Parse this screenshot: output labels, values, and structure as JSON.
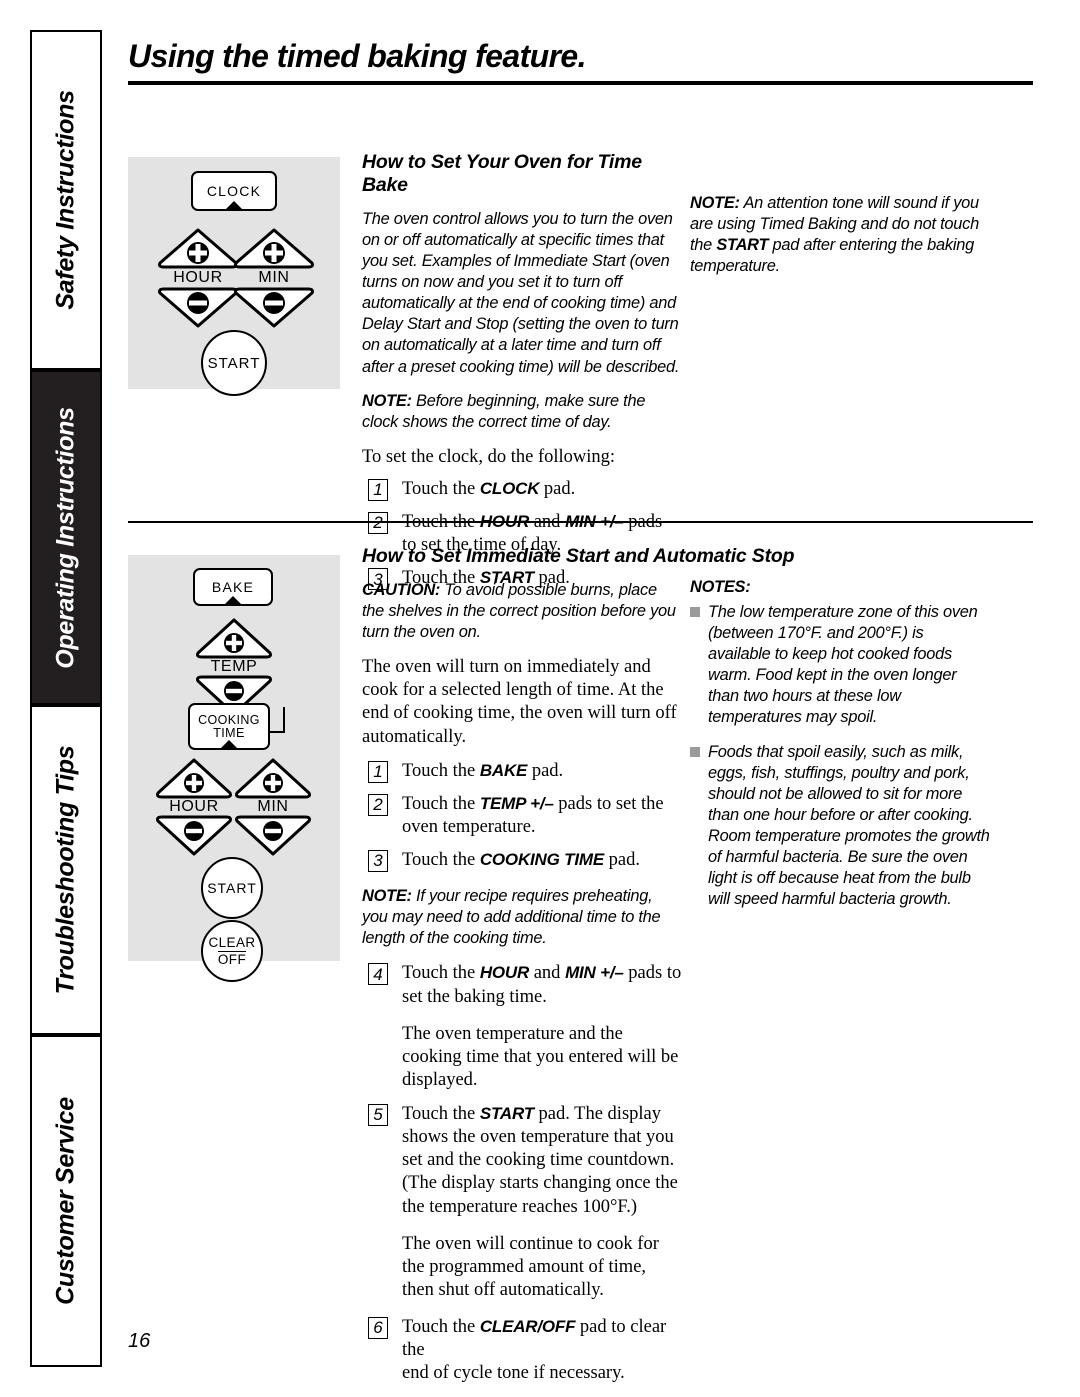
{
  "page": {
    "title": "Using the timed baking feature.",
    "number": "16"
  },
  "sidebar": {
    "tabs": [
      {
        "label": "Safety Instructions",
        "active": false
      },
      {
        "label": "Operating Instructions",
        "active": true
      },
      {
        "label": "Troubleshooting Tips",
        "active": false
      },
      {
        "label": "Customer Service",
        "active": false
      }
    ]
  },
  "colors": {
    "tab_active_bg": "#231f20",
    "panel_bg": "#e3e3e3",
    "bullet_gray": "#9a9a9a",
    "ink": "#000000"
  },
  "section1": {
    "heading": "How to Set Your Oven for Time Bake",
    "panel": {
      "name": "clock-control-panel",
      "pads": [
        {
          "id": "clock",
          "label": "CLOCK",
          "type": "rect"
        },
        {
          "id": "hour",
          "label": "HOUR",
          "type": "plus-minus"
        },
        {
          "id": "min",
          "label": "MIN",
          "type": "plus-minus"
        },
        {
          "id": "start",
          "label": "START",
          "type": "circle"
        }
      ]
    },
    "intro": "The oven control allows you to turn the oven on or off automatically at specific times that you set. Examples of Immediate Start (oven turns on now and you set it to turn off automatically at the end of cooking time) and Delay Start and Stop (setting the oven to turn on automatically at a later time and turn off after a preset cooking time) will be described.",
    "note_label": "NOTE:",
    "note_text": " Before beginning, make sure the clock shows the correct time of day.",
    "lead_in": "To set the clock, do the following:",
    "steps": [
      {
        "num": "1",
        "pre": "Touch the ",
        "pad": "CLOCK",
        "post": " pad.",
        "cont": ""
      },
      {
        "num": "2",
        "pre": "Touch the ",
        "pad": "HOUR",
        "mid": " and ",
        "pad2": "MIN +/–",
        "post": " pads",
        "cont": "to set the time of day."
      },
      {
        "num": "3",
        "pre": "Touch the ",
        "pad": "START",
        "post": " pad.",
        "cont": ""
      }
    ],
    "right_note_label": "NOTE:",
    "right_note_a": " An attention tone will sound if you are using Timed Baking and do not touch the ",
    "right_note_pad": "START",
    "right_note_b": " pad after entering the baking temperature."
  },
  "section2": {
    "heading": "How to Set Immediate Start and Automatic Stop",
    "panel": {
      "name": "bake-control-panel",
      "pads": [
        {
          "id": "bake",
          "label": "BAKE",
          "type": "rect"
        },
        {
          "id": "temp",
          "label": "TEMP",
          "type": "plus-minus"
        },
        {
          "id": "cooking-time",
          "label_line1": "COOKING",
          "label_line2": "TIME",
          "type": "rect-notched"
        },
        {
          "id": "hour",
          "label": "HOUR",
          "type": "plus-minus"
        },
        {
          "id": "min",
          "label": "MIN",
          "type": "plus-minus"
        },
        {
          "id": "start",
          "label": "START",
          "type": "circle"
        },
        {
          "id": "clear-off",
          "label_line1": "CLEAR",
          "label_line2": "OFF",
          "type": "circle"
        }
      ]
    },
    "caution_label": "CAUTION:",
    "caution_text": " To avoid possible burns, place the shelves in the correct position before you turn the oven on.",
    "body": "The oven will turn on immediately and cook for a selected length of time. At the end of cooking time, the oven will turn off automatically.",
    "steps_a": [
      {
        "num": "1",
        "pre": "Touch the ",
        "pad": "BAKE",
        "post": " pad.",
        "cont": ""
      },
      {
        "num": "2",
        "pre": "Touch the ",
        "pad": "TEMP +/–",
        "post": " pads to set the",
        "cont": "oven temperature."
      },
      {
        "num": "3",
        "pre": "Touch the ",
        "pad": "COOKING TIME",
        "post": " pad.",
        "cont": ""
      }
    ],
    "note_label": "NOTE:",
    "note_text": " If your recipe requires preheating, you may need to add additional time to the length of the cooking time.",
    "step4": {
      "num": "4",
      "pre": "Touch the ",
      "pad": "HOUR",
      "mid": " and ",
      "pad2": "MIN +/–",
      "post": " pads to",
      "cont": "set the baking time."
    },
    "para_after_4": "The oven temperature and the cooking time that you entered will be displayed.",
    "step5": {
      "num": "5",
      "pre": "Touch the ",
      "pad": "START",
      "post": " pad. The display",
      "cont": "shows the oven temperature that you set and the cooking time countdown. (The display starts changing once the the temperature reaches 100°F.)"
    },
    "para_after_5": "The oven will continue to cook for the programmed amount of time, then shut off automatically.",
    "step6": {
      "num": "6",
      "pre": "Touch the ",
      "pad": "CLEAR/OFF",
      "post": " pad to clear the",
      "cont": "end of cycle tone if necessary."
    },
    "notes_label": "NOTES:",
    "notes": [
      "The low temperature zone of this oven (between 170°F. and 200°F.) is available to keep hot cooked foods warm. Food kept in the oven longer than two hours at these low temperatures may spoil.",
      "Foods that spoil easily, such as milk, eggs, fish, stuffings, poultry and pork, should not be allowed to sit for more than one hour before or after cooking. Room temperature promotes the growth of harmful bacteria. Be sure the oven light is off because heat from the bulb will speed harmful bacteria growth."
    ]
  }
}
